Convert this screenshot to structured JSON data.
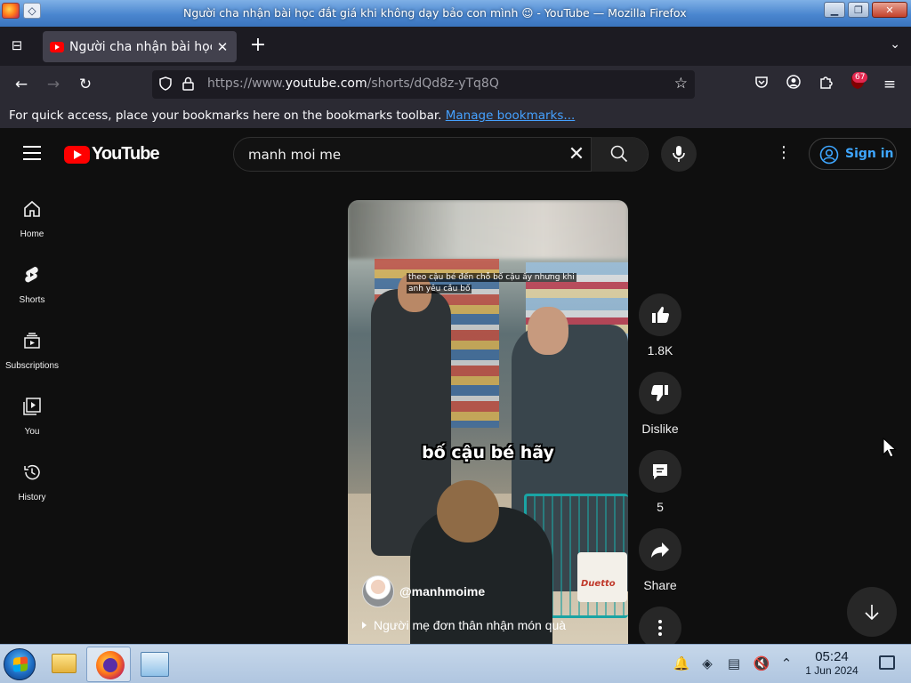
{
  "window": {
    "title": "Người cha nhận bài học đắt giá khi không dạy bảo con mình 😉 - YouTube — Mozilla Firefox",
    "controls": [
      "minimize",
      "maximize",
      "close"
    ]
  },
  "browser": {
    "tab_title": "Người cha nhận bài học đắt",
    "url_prefix": "https://www.",
    "url_domain": "youtube.com",
    "url_path": "/shorts/dQd8z-yTq8Q",
    "extension_badge": "67",
    "bookmarks_text": "For quick access, place your bookmarks here on the bookmarks toolbar.",
    "bookmarks_link": "Manage bookmarks..."
  },
  "youtube": {
    "logo_text": "YouTube",
    "search_query": "manh moi me",
    "sign_in": "Sign in",
    "sidebar": [
      {
        "label": "Home",
        "icon": "home-icon"
      },
      {
        "label": "Shorts",
        "icon": "shorts-icon"
      },
      {
        "label": "Subscriptions",
        "icon": "subscriptions-icon"
      },
      {
        "label": "You",
        "icon": "you-icon"
      },
      {
        "label": "History",
        "icon": "history-icon"
      }
    ],
    "short": {
      "subtitle_top_line1": "theo cậu bé đến chỗ bố cậu ấy nhưng khi",
      "subtitle_top_line2": "anh yêu cầu bố",
      "caption": "bố cậu bé hãy",
      "channel": "@manhmoime",
      "sound": "Người mẹ đơn thân nhận món quà",
      "product_label": "Duetto"
    },
    "actions": {
      "like": "1.8K",
      "dislike": "Dislike",
      "comments": "5",
      "share": "Share"
    }
  },
  "taskbar": {
    "time": "05:24",
    "date": "1 Jun 2024"
  }
}
